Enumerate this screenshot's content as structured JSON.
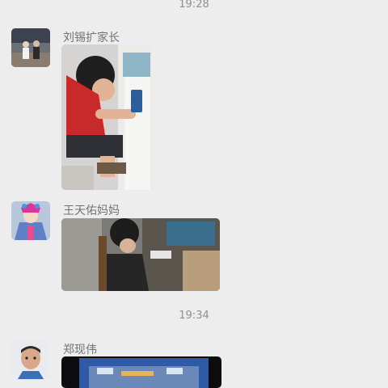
{
  "chat": {
    "timestamps": [
      "19:28",
      "19:34"
    ],
    "messages": [
      {
        "sender": "刘锡扩家长",
        "avatar_icon": "group-photo-avatar-icon",
        "content_type": "image"
      },
      {
        "sender": "王天佑妈妈",
        "avatar_icon": "opera-mask-avatar-icon",
        "content_type": "image"
      },
      {
        "sender": "郑现伟",
        "avatar_icon": "child-portrait-avatar-icon",
        "content_type": "image"
      }
    ]
  },
  "colors": {
    "background": "#ededed",
    "timestamp": "#8f8f8f",
    "sender_name": "#737373"
  }
}
